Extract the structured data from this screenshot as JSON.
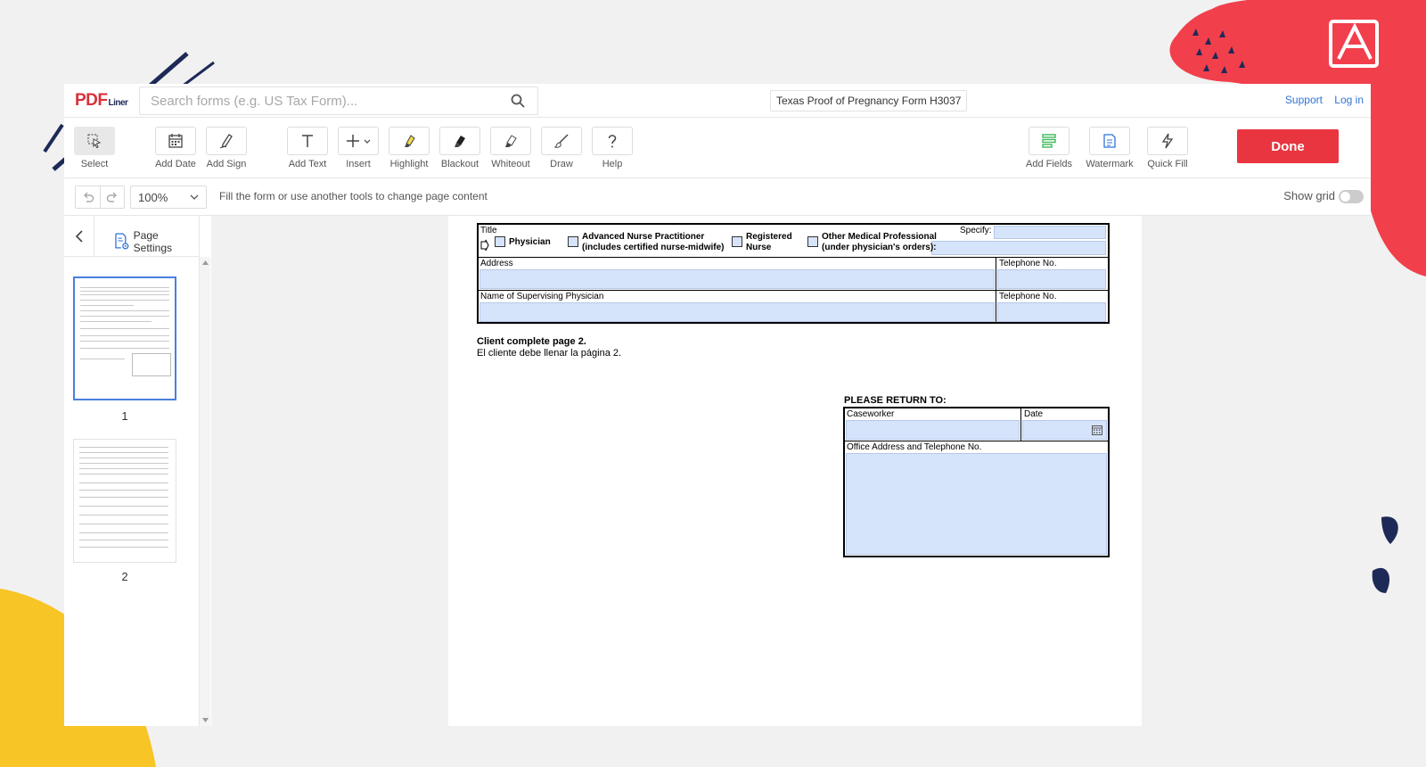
{
  "app": {
    "logo_main": "PDF",
    "logo_sub": "Liner",
    "search_placeholder": "Search forms (e.g. US Tax Form)...",
    "document_title": "Texas Proof of Pregnancy Form H3037",
    "links": {
      "support": "Support",
      "login": "Log in"
    }
  },
  "toolbar": {
    "tools": [
      {
        "label": "Select",
        "icon": "cursor-select-icon"
      },
      {
        "label": "Add Date",
        "icon": "calendar-icon"
      },
      {
        "label": "Add Sign",
        "icon": "pen-sign-icon"
      },
      {
        "label": "Add Text",
        "icon": "text-t-icon"
      },
      {
        "label": "Insert",
        "icon": "plus-icon"
      },
      {
        "label": "Highlight",
        "icon": "highlighter-icon"
      },
      {
        "label": "Blackout",
        "icon": "blackout-icon"
      },
      {
        "label": "Whiteout",
        "icon": "eraser-icon"
      },
      {
        "label": "Draw",
        "icon": "brush-icon"
      },
      {
        "label": "Help",
        "icon": "question-icon"
      }
    ],
    "right_tools": [
      {
        "label": "Add Fields",
        "icon": "fields-icon"
      },
      {
        "label": "Watermark",
        "icon": "watermark-icon"
      },
      {
        "label": "Quick Fill",
        "icon": "lightning-icon"
      }
    ],
    "done_label": "Done"
  },
  "subbar": {
    "zoom": "100%",
    "hint": "Fill the form or use another tools to change page content",
    "show_grid_label": "Show grid"
  },
  "sidebar": {
    "page_settings_label": "Page Settings",
    "pages": [
      "1",
      "2"
    ]
  },
  "form": {
    "title_label": "Title",
    "specify_label": "Specify:",
    "options": {
      "physician": "Physician",
      "anp_line1": "Advanced Nurse Practitioner",
      "anp_line2": "(includes certified nurse-midwife)",
      "rn_line1": "Registered",
      "rn_line2": "Nurse",
      "other_line1": "Other Medical Professional",
      "other_line2": "(under physician's orders):"
    },
    "address_label": "Address",
    "telephone_label": "Telephone No.",
    "supervising_label": "Name of Supervising Physician",
    "telephone_label_2": "Telephone No.",
    "client_bold": "Client complete page 2.",
    "client_es": "El cliente debe llenar la página 2.",
    "return_title": "PLEASE RETURN TO:",
    "caseworker_label": "Caseworker",
    "date_label": "Date",
    "office_label": "Office Address and Telephone No."
  },
  "colors": {
    "accent": "#e8353f",
    "link": "#2f73d9",
    "field_fill": "#d6e4fb",
    "thumb_active": "#4a7fdc"
  }
}
